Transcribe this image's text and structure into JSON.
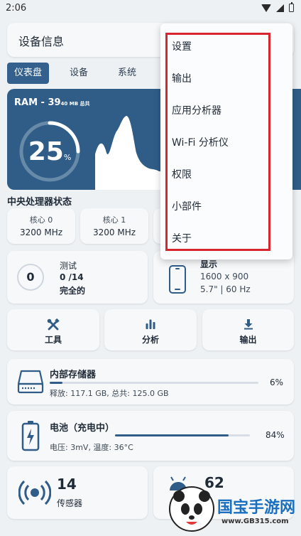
{
  "status": {
    "time": "2:06"
  },
  "header": {
    "title": "设备信息"
  },
  "tabs": [
    "仪表盘",
    "设备",
    "系统"
  ],
  "ram": {
    "label": "RAM - 39",
    "total_note": "40 MB 总共",
    "percent": "25",
    "percent_sign": "%",
    "usage_fraction": 0.25
  },
  "cpu": {
    "title": "中央处理器状态",
    "cores": [
      {
        "label": "核心 0",
        "value": "3200 MHz"
      },
      {
        "label": "核心 1",
        "value": "3200 MHz"
      }
    ]
  },
  "tests": {
    "count": "0",
    "title": "测试",
    "progress": "0 /14",
    "status": "完全的"
  },
  "display": {
    "title": "显示",
    "resolution": "1600 x 900",
    "details": "5.7\" | 60 Hz"
  },
  "actions": {
    "tools": "工具",
    "analyze": "分析",
    "export": "输出"
  },
  "storage": {
    "title": "内部存储器",
    "details": "释放: 117.1 GB, 总共: 125.0 GB",
    "percent": "6%",
    "fraction": 0.06
  },
  "battery": {
    "title": "电池（充电中）",
    "details": "电压: 3mV, 温度: 36°C",
    "percent": "84%",
    "fraction": 0.84
  },
  "sensors": {
    "count": "14",
    "label": "传感器"
  },
  "apps": {
    "count": "62"
  },
  "menu": {
    "items": [
      "设置",
      "输出",
      "应用分析器",
      "Wi-Fi 分析仪",
      "权限",
      "小部件",
      "关于"
    ]
  },
  "watermark": {
    "brand": "国宝手游网",
    "url": "www.GB315.com"
  },
  "colors": {
    "primary": "#2f5d88",
    "highlight": "#d7262e"
  }
}
